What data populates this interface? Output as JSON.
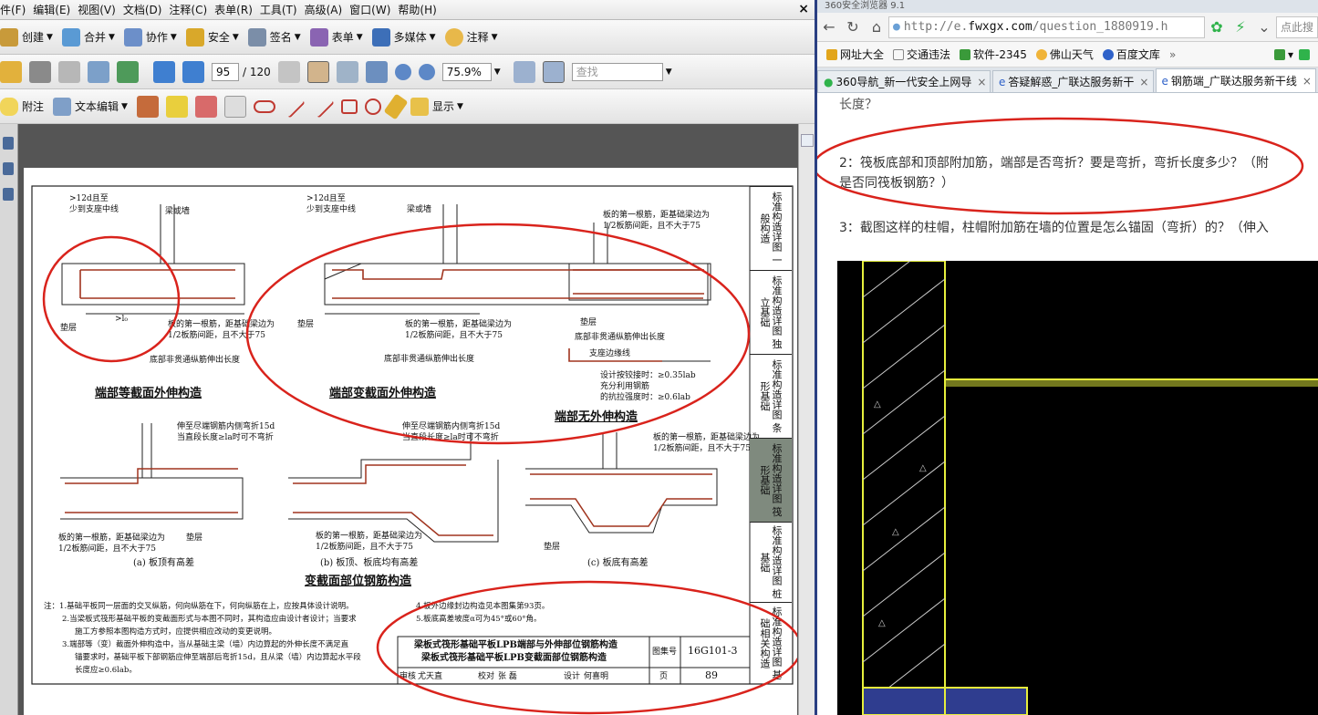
{
  "pdf": {
    "menu": [
      "件(F)",
      "编辑(E)",
      "视图(V)",
      "文档(D)",
      "注释(C)",
      "表单(R)",
      "工具(T)",
      "高级(A)",
      "窗口(W)",
      "帮助(H)"
    ],
    "close": "×",
    "toolbar1": {
      "create": "创建",
      "combine": "合并",
      "collaborate": "协作",
      "secure": "安全",
      "sign": "签名",
      "forms": "表单",
      "multimedia": "多媒体",
      "comment": "注释"
    },
    "toolbar2": {
      "page_current": "95",
      "page_total": "/ 120",
      "zoom": "75.9%",
      "search_placeholder": "查找"
    },
    "toolbar3": {
      "note": "附注",
      "text_edit": "文本编辑",
      "show": "显示"
    },
    "drawing": {
      "titles": [
        "端部等截面外伸构造",
        "端部变截面外伸构造",
        "端部无外伸构造",
        "变截面部位钢筋构造"
      ],
      "sublabels": [
        "(a)  板顶有高差",
        "(b)  板顶、板底均有高差",
        "(c)  板底有高差"
      ],
      "labels": [
        ">12d且至",
        "少到支座中线",
        "梁或墙",
        "垫层",
        ">l₀",
        "板的第一根筋，距基础梁边为",
        "1/2板筋间距，且不大于75",
        "底部非贯通纵筋伸出长度",
        "设计按铰接时：≥0.35lab",
        "充分利用钢筋",
        "的抗拉强度时：≥0.6lab",
        "伸至尽端钢筋内侧弯折15d",
        "当直段长度≥la时可不弯折",
        "支座边缘线"
      ],
      "notes": [
        "注：1.基础平板同一层面的交叉纵筋，何向纵筋在下，何向纵筋在上，应按具体设计说明。",
        "2.当梁板式筏形基础平板的变截面形式与本图不同时，其构造应由设计者设计；当要求",
        "施工方参照本图构造方式时，应提供相应改动的变更说明。",
        "3.端部等（变）截面外伸构造中，当从基础主梁（墙）内边算起的外伸长度不满足直",
        "锚要求时，基础平板下部钢筋应伸至端部后弯折15d，且从梁（墙）内边算起水平段",
        "长度应≥0.6lab。",
        "4.板外边缘封边构造见本图集第93页。",
        "5.板底高差坡度α可为45°或60°角。"
      ],
      "title_block": {
        "line1": "梁板式筏形基础平板LPB端部与外伸部位钢筋构造",
        "line2": "梁板式筏形基础平板LPB变截面部位钢筋构造",
        "atlas_label": "图集号",
        "atlas_no": "16G101-3",
        "page_label": "页",
        "page_no": "89",
        "review": "审核",
        "review_name": "尤天直",
        "check": "校对",
        "check_name": "张 磊",
        "design": "设计",
        "design_name": "何喜明"
      },
      "side_tabs": [
        "标准构造详图 一般构造",
        "标准构造详图 独立基础",
        "标准构造详图 条形基础",
        "标准构造详图 筏形基础",
        "标准构造详图 桩基础",
        "标准构造详图 基础相关构造"
      ]
    }
  },
  "browser": {
    "window_title": "360安全浏览器 9.1",
    "url_prefix": "http://e.",
    "url_domain": "fwxgx.com",
    "url_path": "/question_1880919.h",
    "search_hint": "点此搜",
    "bookmarks": [
      "网址大全",
      "交通违法",
      "软件-2345",
      "佛山天气",
      "百度文库"
    ],
    "tabs": [
      {
        "label": "360导航_新一代安全上网导",
        "active": false
      },
      {
        "label": "答疑解惑_广联达服务新干",
        "active": false
      },
      {
        "label": "钢筋端_广联达服务新干线",
        "active": true
      }
    ],
    "question_lines": [
      "长度？",
      "2：筏板底部和顶部附加筋，端部是否弯折？要是弯折，弯折长度多少？（附",
      "是否同筏板钢筋？）",
      "3：截图这样的柱帽，柱帽附加筋在墙的位置是怎么锚固（弯折）的？（伸入"
    ]
  },
  "colors": {
    "annotation_red": "#d9231c",
    "cad_yellow": "#e6ef3c",
    "cad_blue": "#2f3d8f",
    "rebar_red": "#a0341e"
  }
}
